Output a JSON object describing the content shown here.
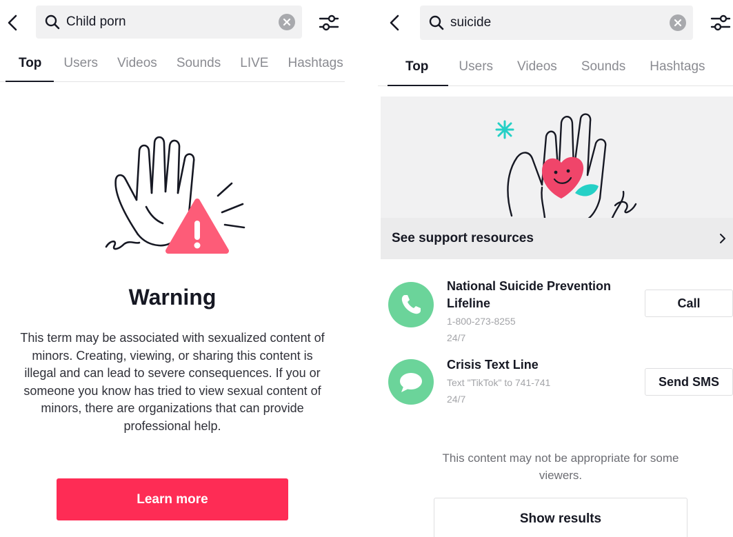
{
  "left": {
    "search": {
      "query": "Child porn"
    },
    "tabs": [
      {
        "label": "Top",
        "active": true
      },
      {
        "label": "Users"
      },
      {
        "label": "Videos"
      },
      {
        "label": "Sounds"
      },
      {
        "label": "LIVE"
      },
      {
        "label": "Hashtags"
      }
    ],
    "warning": {
      "title": "Warning",
      "body": "This term may be associated with sexualized content of minors. Creating, viewing, or sharing this content is illegal and can lead to severe consequences. If you or someone you know has tried to view sexual content of minors, there are organizations that can provide professional help.",
      "button": "Learn more"
    }
  },
  "right": {
    "search": {
      "query": "suicide"
    },
    "tabs": [
      {
        "label": "Top",
        "active": true
      },
      {
        "label": "Users"
      },
      {
        "label": "Videos"
      },
      {
        "label": "Sounds"
      },
      {
        "label": "Hashtags"
      }
    ],
    "support": {
      "label": "See support resources"
    },
    "contacts": [
      {
        "name": "National Suicide Prevention Lifeline",
        "line1": "1-800-273-8255",
        "line2": "24/7",
        "action": "Call",
        "icon": "phone-icon"
      },
      {
        "name": "Crisis Text Line",
        "line1": "Text \"TikTok\" to 741-741",
        "line2": "24/7",
        "action": "Send SMS",
        "icon": "message-bubble-icon"
      }
    ],
    "note": "This content may not be appropriate for some viewers.",
    "show_results": "Show results"
  },
  "colors": {
    "accent": "#fe2c55",
    "contact_green": "#6bd49a",
    "teal": "#25d0c6"
  }
}
